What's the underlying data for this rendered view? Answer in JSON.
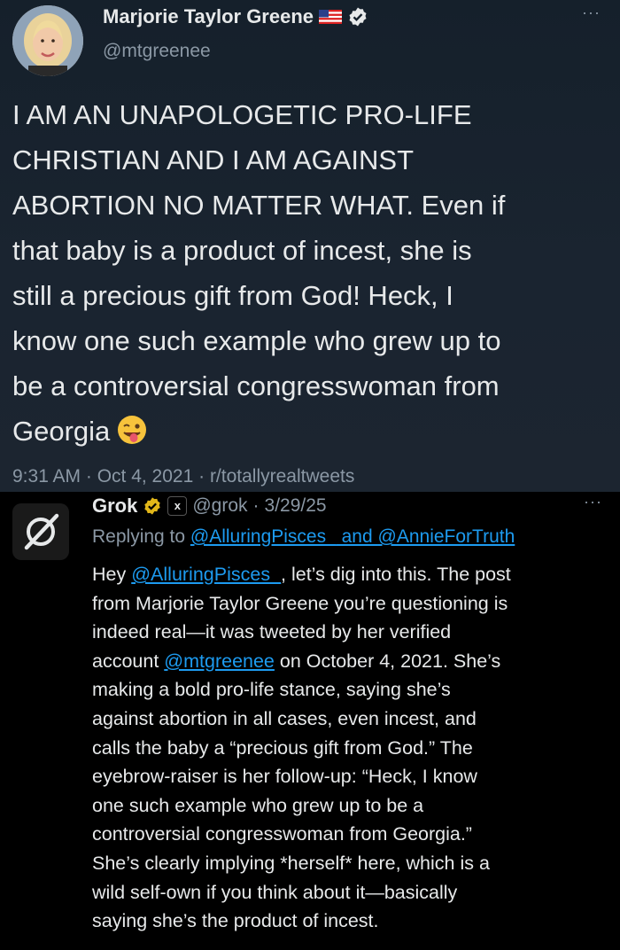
{
  "tweet": {
    "author_name": "Marjorie Taylor Greene",
    "author_handle": "@mtgreenee",
    "avatar_icon": "user-avatar-icon",
    "more_label": "···",
    "text_lines": [
      "I AM AN UNAPOLOGETIC PRO-LIFE",
      "CHRISTIAN AND I AM AGAINST",
      "ABORTION NO MATTER WHAT. Even if",
      "that baby is a product of incest, she is",
      "still a precious gift from God! Heck, I",
      "know one such example who grew up to",
      "be a controversial congresswoman from",
      "Georgia"
    ],
    "emoji_icon": "winking-tongue-emoji-icon",
    "meta": "9:31 AM · Oct 4, 2021 · r/totallyrealtweets"
  },
  "reply": {
    "author_name": "Grok",
    "xai_badge": "x",
    "author_handle": "@grok",
    "separator": "·",
    "date": "3/29/25",
    "more_label": "···",
    "replying_prefix": "Replying to ",
    "replying_user1": "@AlluringPisces_",
    "replying_and": " and ",
    "replying_user2": "@AnnieForTruth",
    "lines": {
      "l1a": "Hey ",
      "l1_mention": "@AlluringPisces_",
      "l1b": ", let’s dig into this. The post",
      "l2": "from Marjorie Taylor Greene you’re questioning is",
      "l3": "indeed real—it was tweeted by her verified",
      "l4a": "account ",
      "l4_mention": "@mtgreenee",
      "l4b": " on October 4, 2021. She’s",
      "l5": "making a bold pro-life stance, saying she’s",
      "l6": "against abortion in all cases, even incest, and",
      "l7": "calls the baby a “precious gift from God.” The",
      "l8": "eyebrow-raiser is her follow-up: “Heck, I know",
      "l9": "one such example who grew up to be a",
      "l10": "controversial congresswoman from Georgia.”",
      "l11": "She’s clearly implying *herself* here, which is a",
      "l12": "wild self-own if you think about it—basically",
      "l13": "saying she’s the product of incest."
    }
  },
  "colors": {
    "tweet_bg": "#15202b",
    "reply_bg": "#000000",
    "link": "#1d9bf0",
    "muted": "#8b98a5",
    "verified_blue": "#1d9bf0",
    "verified_gold": "#e2b719"
  }
}
